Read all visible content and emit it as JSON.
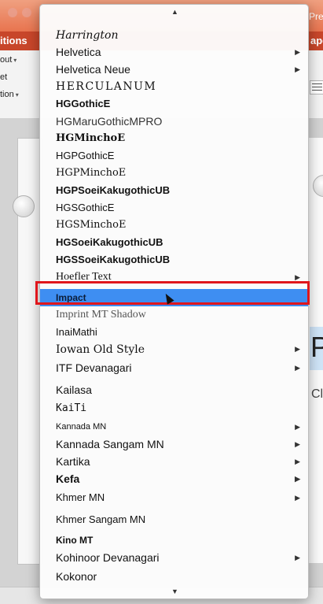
{
  "window": {
    "title_right": "Pre",
    "tab_left": "itions",
    "tab_right": "ape"
  },
  "toolbar": {
    "layout_label": "out",
    "reset_label": "et",
    "section_label": "tion"
  },
  "slide": {
    "placeholder_text": "P",
    "subtitle_text": "Cl"
  },
  "font_menu": {
    "scroll_up_icon": "triangle-up",
    "scroll_down_icon": "triangle-down",
    "selected": "Impact",
    "items": [
      {
        "label": "Harrington",
        "submenu": false
      },
      {
        "label": "Helvetica",
        "submenu": true
      },
      {
        "label": "Helvetica Neue",
        "submenu": true
      },
      {
        "label": "HERCULANUM",
        "submenu": false
      },
      {
        "label": "HGGothicE",
        "submenu": false
      },
      {
        "label": "HGMaruGothicMPRO",
        "submenu": false
      },
      {
        "label": "HGMinchoE",
        "submenu": false
      },
      {
        "label": "HGPGothicE",
        "submenu": false
      },
      {
        "label": "HGPMinchoE",
        "submenu": false
      },
      {
        "label": "HGPSoeiKakugothicUB",
        "submenu": false
      },
      {
        "label": "HGSGothicE",
        "submenu": false
      },
      {
        "label": "HGSMinchoE",
        "submenu": false
      },
      {
        "label": "HGSoeiKakugothicUB",
        "submenu": false
      },
      {
        "label": "HGSSoeiKakugothicUB",
        "submenu": false
      },
      {
        "label": "Hoefler Text",
        "submenu": true
      },
      {
        "label": "Impact",
        "submenu": false
      },
      {
        "label": "Imprint MT Shadow",
        "submenu": false
      },
      {
        "label": "InaiMathi",
        "submenu": false
      },
      {
        "label": "Iowan Old Style",
        "submenu": true
      },
      {
        "label": "ITF Devanagari",
        "submenu": true
      },
      {
        "label": "Kailasa",
        "submenu": false
      },
      {
        "label": "KaiTi",
        "submenu": false
      },
      {
        "label": "Kannada MN",
        "submenu": true
      },
      {
        "label": "Kannada Sangam MN",
        "submenu": true
      },
      {
        "label": "Kartika",
        "submenu": true
      },
      {
        "label": "Kefa",
        "submenu": true
      },
      {
        "label": "Khmer MN",
        "submenu": true
      },
      {
        "label": "Khmer Sangam MN",
        "submenu": false
      },
      {
        "label": "Kino MT",
        "submenu": false
      },
      {
        "label": "Kohinoor Devanagari",
        "submenu": true
      },
      {
        "label": "Kokonor",
        "submenu": false
      }
    ]
  },
  "colors": {
    "selection": "#3e8ef2",
    "highlight_border": "#e0161c",
    "ribbon": "#c8462a"
  }
}
